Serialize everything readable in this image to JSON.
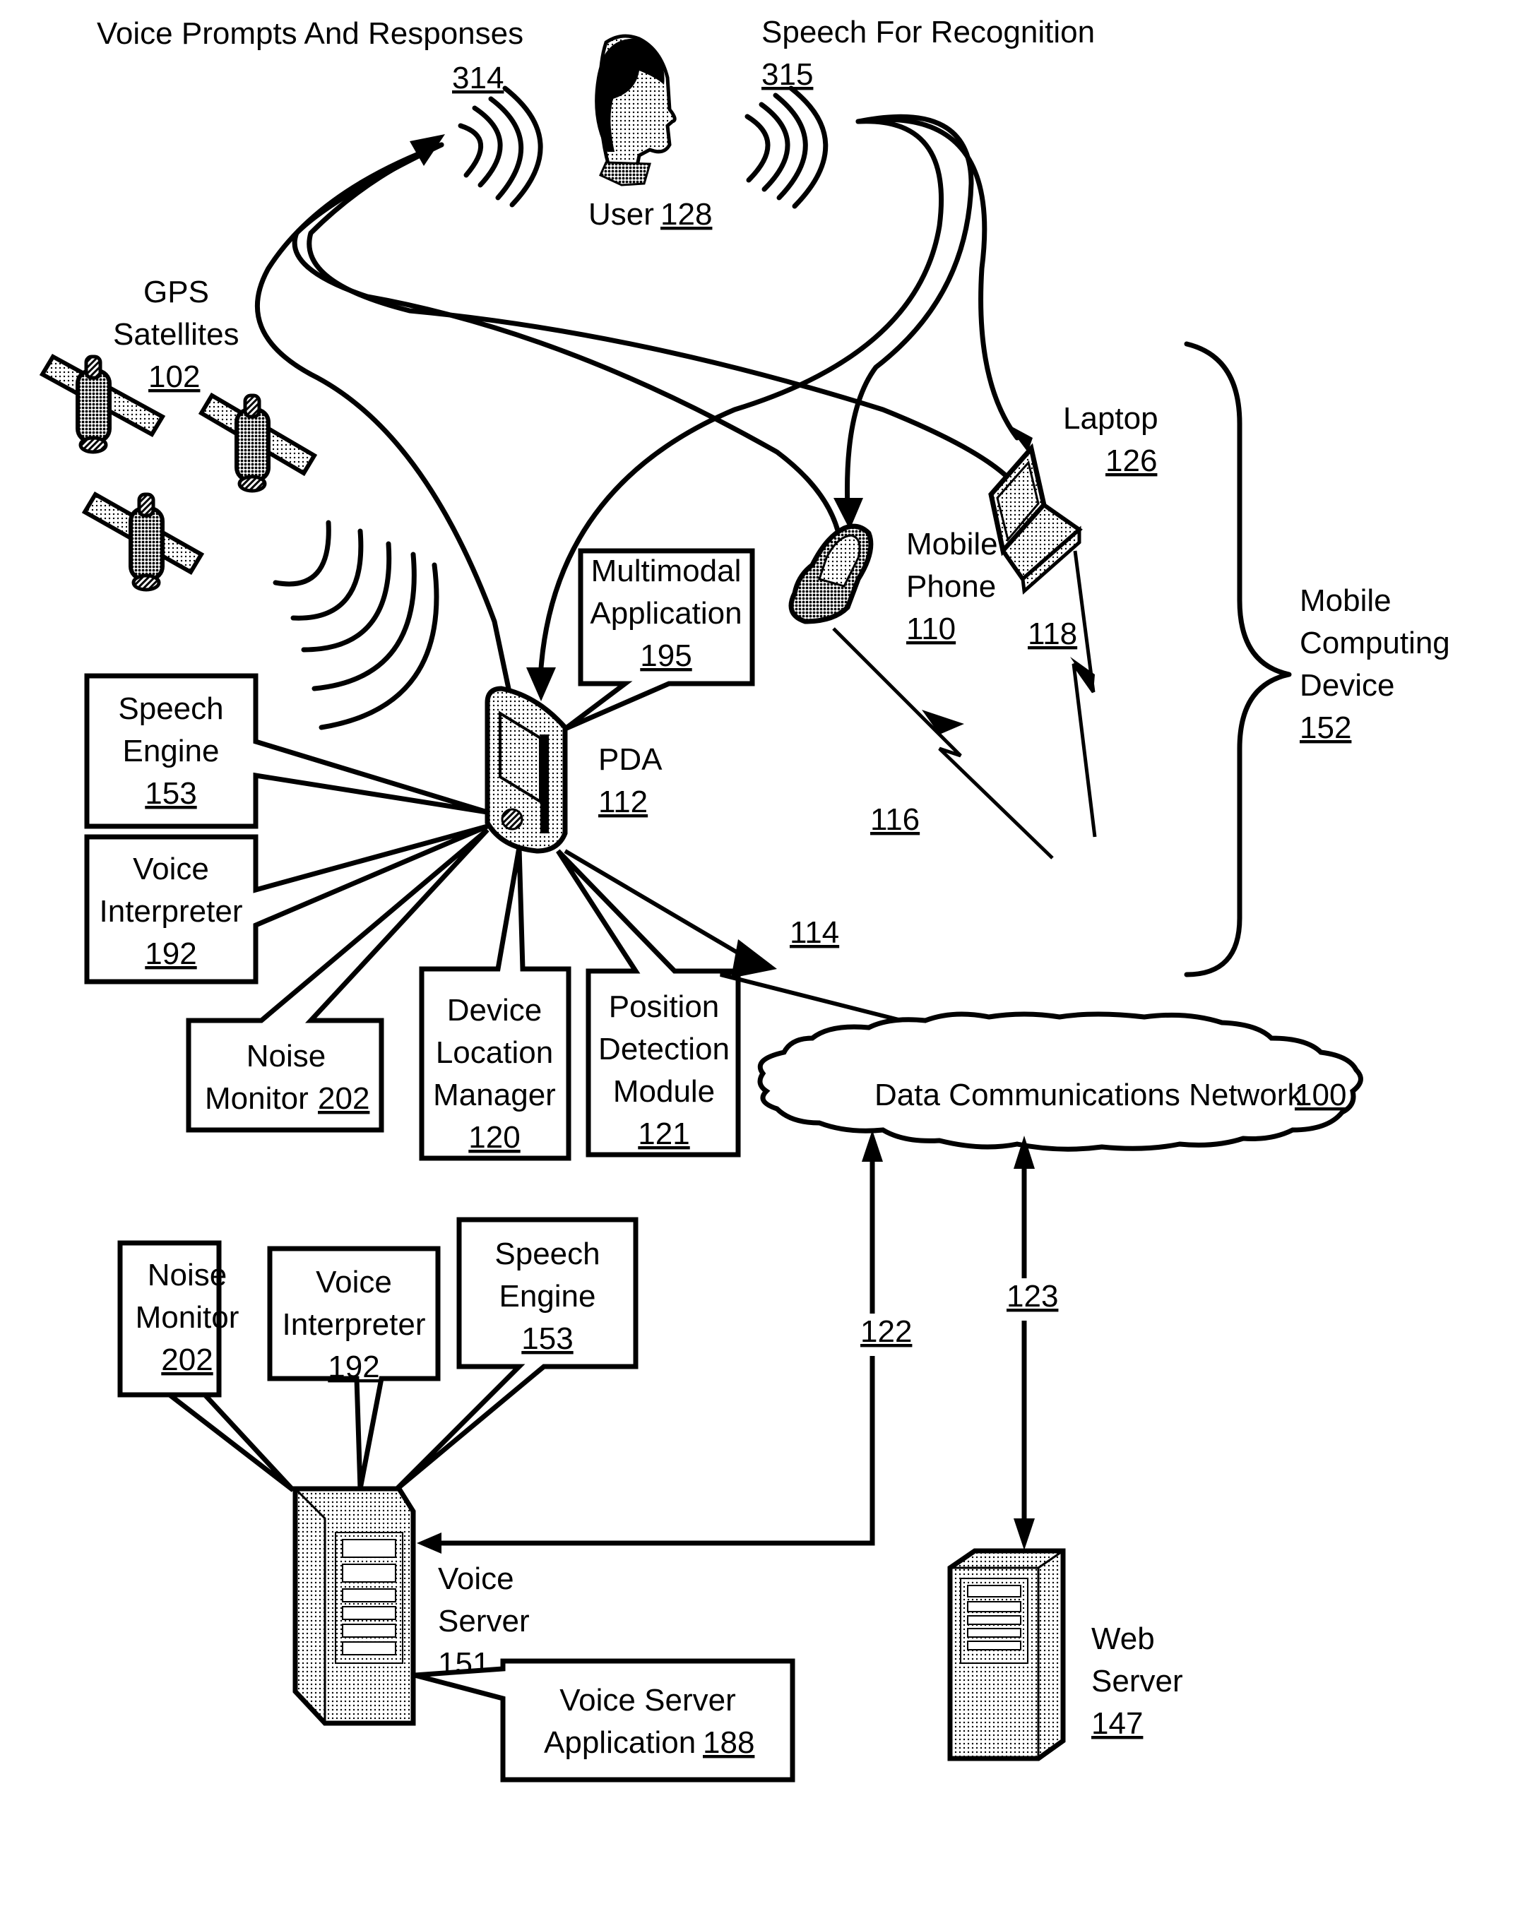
{
  "figure": {
    "top_labels": {
      "voice_prompts": {
        "text": "Voice Prompts And Responses",
        "ref": "314"
      },
      "speech_recognition": {
        "text": "Speech For Recognition",
        "ref": "315"
      }
    },
    "user": {
      "text": "User",
      "ref": "128"
    },
    "gps": {
      "line1": "GPS",
      "line2": "Satellites",
      "ref": "102"
    },
    "laptop": {
      "text": "Laptop",
      "ref": "126"
    },
    "mobile_phone": {
      "line1": "Mobile",
      "line2": "Phone",
      "ref": "110"
    },
    "pda": {
      "text": "PDA",
      "ref": "112"
    },
    "mobile_computing_device": {
      "line1": "Mobile",
      "line2": "Computing",
      "line3": "Device",
      "ref": "152"
    },
    "multimodal_app": {
      "line1": "Multimodal",
      "line2": "Application",
      "ref": "195"
    },
    "pda_speech_engine": {
      "line1": "Speech",
      "line2": "Engine",
      "ref": "153"
    },
    "pda_voice_interpreter": {
      "line1": "Voice",
      "line2": "Interpreter",
      "ref": "192"
    },
    "pda_noise_monitor": {
      "line1": "Noise",
      "line2": "Monitor",
      "ref": "202"
    },
    "device_location_manager": {
      "line1": "Device",
      "line2": "Location",
      "line3": "Manager",
      "ref": "120"
    },
    "position_detection_module": {
      "line1": "Position",
      "line2": "Detection",
      "line3": "Module",
      "ref": "121"
    },
    "links": {
      "pda_link": "114",
      "phone_link": "116",
      "laptop_link": "118",
      "voice_server_link": "122",
      "web_server_link": "123"
    },
    "network": {
      "text": "Data Communications Network",
      "ref": "100"
    },
    "server_noise_monitor": {
      "line1": "Noise",
      "line2": "Monitor",
      "ref": "202"
    },
    "server_voice_interpreter": {
      "line1": "Voice",
      "line2": "Interpreter",
      "ref": "192"
    },
    "server_speech_engine": {
      "line1": "Speech",
      "line2": "Engine",
      "ref": "153"
    },
    "voice_server": {
      "line1": "Voice",
      "line2": "Server",
      "ref": "151"
    },
    "voice_server_app": {
      "line1": "Voice Server",
      "line2": "Application",
      "ref": "188"
    },
    "web_server": {
      "line1": "Web",
      "line2": "Server",
      "ref": "147"
    }
  }
}
